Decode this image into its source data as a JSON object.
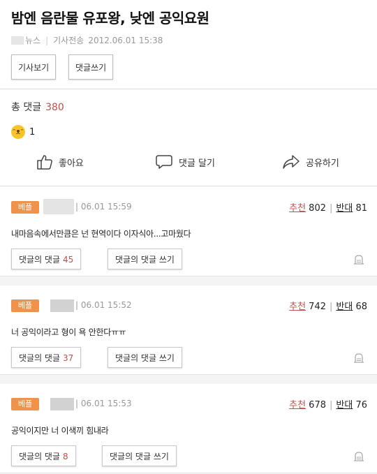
{
  "article": {
    "title": "밤엔 음란물 유포왕, 낮엔 공익요원",
    "source": "뉴스",
    "meta_label": "기사전송",
    "datetime": "2012.06.01 15:38",
    "view_article_button": "기사보기",
    "write_comment_button": "댓글쓰기"
  },
  "summary": {
    "total_label": "총 댓글",
    "total_count": "380",
    "reaction_count": "1",
    "like_label": "좋아요",
    "reply_label": "댓글 달기",
    "share_label": "공유하기"
  },
  "comments": [
    {
      "badge": "베플",
      "time": "06.01 15:59",
      "up_label": "추천",
      "up_count": "802",
      "down_label": "반대",
      "down_count": "81",
      "text": "내마음속에서만큼은 넌 현역이다 이자식아...고마웠다",
      "reply_label": "댓글의 댓글",
      "reply_count": "45",
      "write_reply_label": "댓글의 댓글 쓰기"
    },
    {
      "badge": "베플",
      "time": "06.01 15:52",
      "up_label": "추천",
      "up_count": "742",
      "down_label": "반대",
      "down_count": "68",
      "text": "너 공익이라고 형이 욕 안한다ㅠㅠ",
      "reply_label": "댓글의 댓글",
      "reply_count": "37",
      "write_reply_label": "댓글의 댓글 쓰기"
    },
    {
      "badge": "베플",
      "time": "06.01 15:53",
      "up_label": "추천",
      "up_count": "678",
      "down_label": "반대",
      "down_count": "76",
      "text": "공익이지만 너 이색끼 힘내라",
      "reply_label": "댓글의 댓글",
      "reply_count": "8",
      "write_reply_label": "댓글의 댓글 쓰기"
    }
  ],
  "colors": {
    "accent_red": "#c0504d",
    "badge_orange": "#f0924a"
  }
}
